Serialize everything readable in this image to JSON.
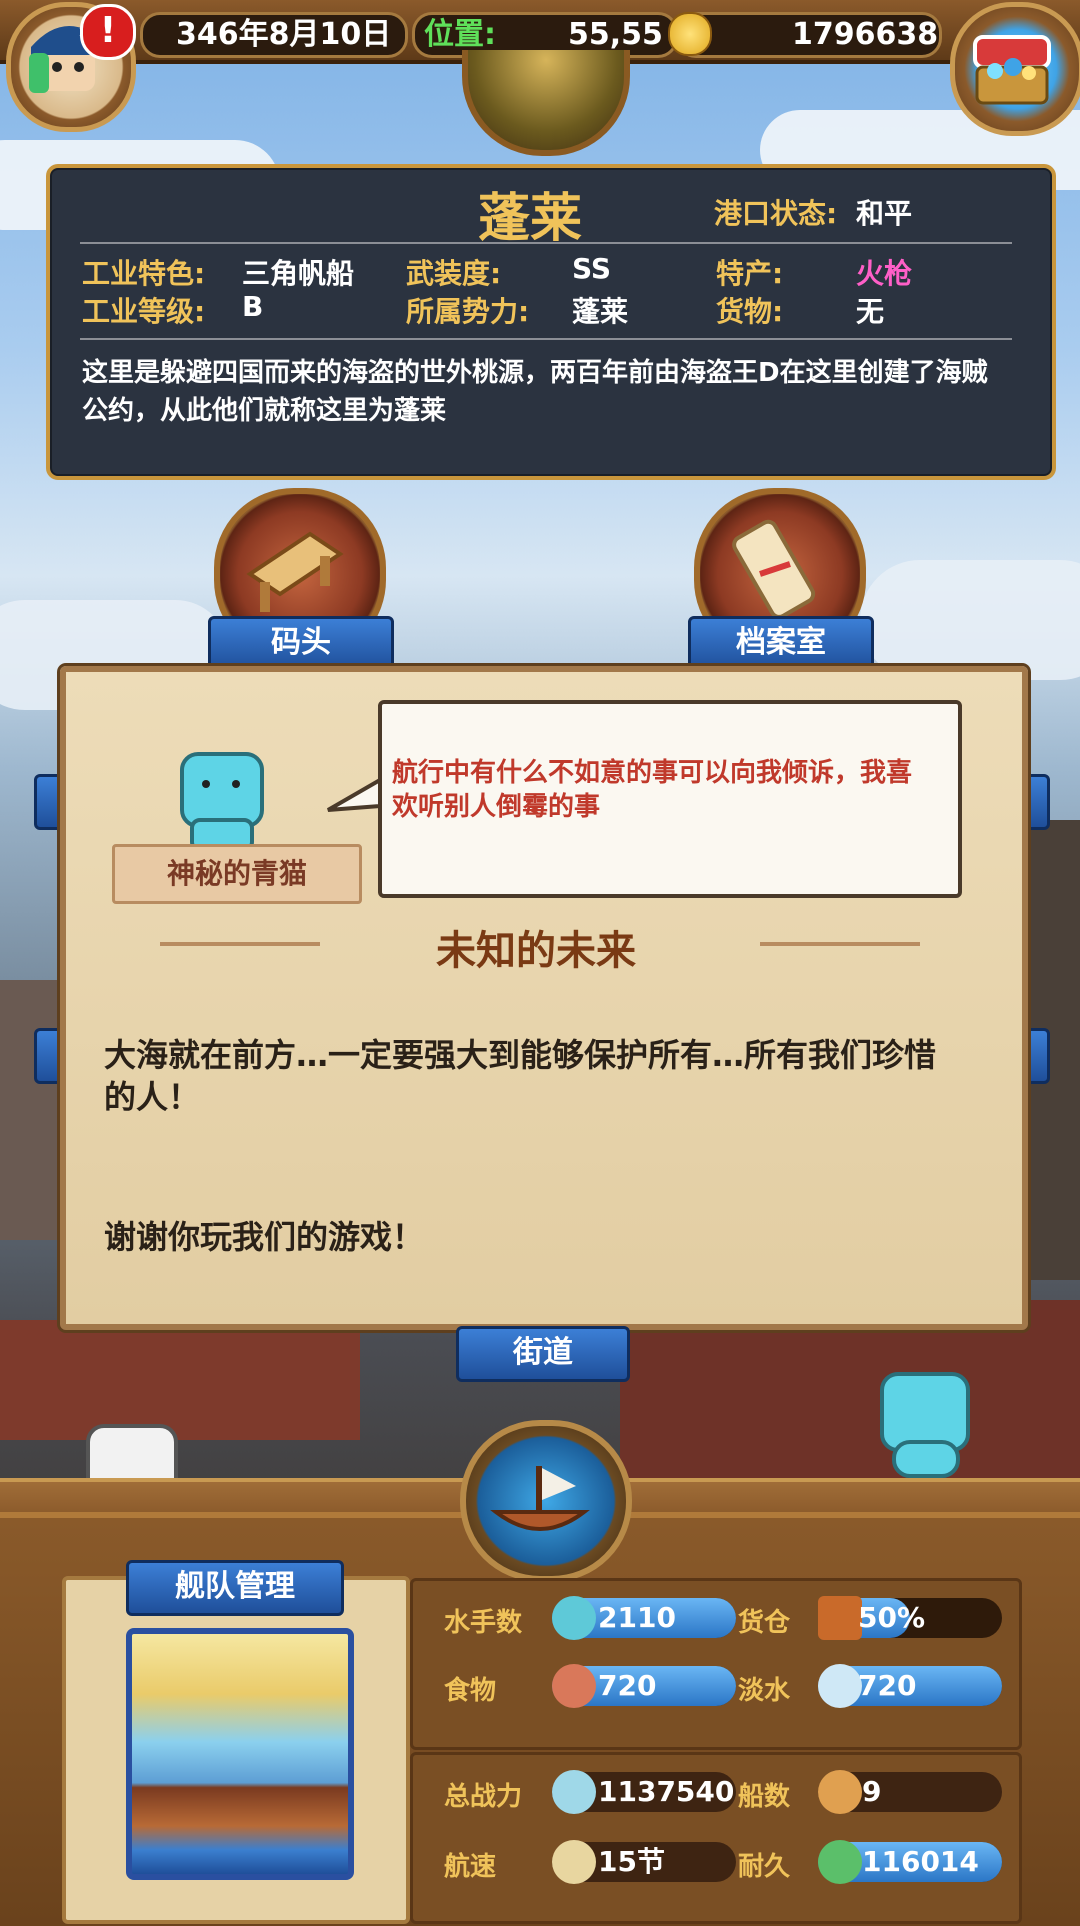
{
  "topbar": {
    "date": "346年8月10日",
    "position_label": "位置:",
    "position_value": "55,55",
    "gold": "1796638",
    "alert_icon": "exclamation-icon"
  },
  "port": {
    "name": "蓬莱",
    "status_label": "港口状态:",
    "status_value": "和平",
    "industry_feature_label": "工业特色:",
    "industry_feature_value": "三角帆船",
    "armament_label": "武装度:",
    "armament_value": "SS",
    "specialty_label": "特产:",
    "specialty_value": "火枪",
    "industry_level_label": "工业等级:",
    "industry_level_value": "B",
    "faction_label": "所属势力:",
    "faction_value": "蓬莱",
    "cargo_label": "货物:",
    "cargo_value": "无",
    "description": "这里是躲避四国而来的海盗的世外桃源，两百年前由海盗王D在这里创建了海贼公约，从此他们就称这里为蓬莱"
  },
  "buttons": {
    "dock": "码头",
    "archive": "档案室",
    "street": "街道"
  },
  "dialog": {
    "speaker_name": "神秘的青猫",
    "speech": "航行中有什么不如意的事可以向我倾诉，我喜欢听别人倒霉的事",
    "title": "未知的未来",
    "body1": "大海就在前方…一定要强大到能够保护所有…所有我们珍惜的人！",
    "body2": "谢谢你玩我们的游戏！"
  },
  "fleet": {
    "title": "舰队管理",
    "sailors_label": "水手数",
    "sailors_value": "2110",
    "hold_label": "货仓",
    "hold_value": "50%",
    "hold_fraction": 0.5,
    "food_label": "食物",
    "food_value": "720",
    "water_label": "淡水",
    "water_value": "720",
    "power_label": "总战力",
    "power_value": "1137540",
    "ships_label": "船数",
    "ships_value": "9",
    "speed_label": "航速",
    "speed_value": "15节",
    "durability_label": "耐久",
    "durability_value": "116014"
  },
  "colors": {
    "gold_text": "#f0c35a",
    "pink_text": "#ff5fc8",
    "speech_text": "#c0392b",
    "title_text": "#7a3a14",
    "ribbon_blue": "#2b62b8"
  }
}
